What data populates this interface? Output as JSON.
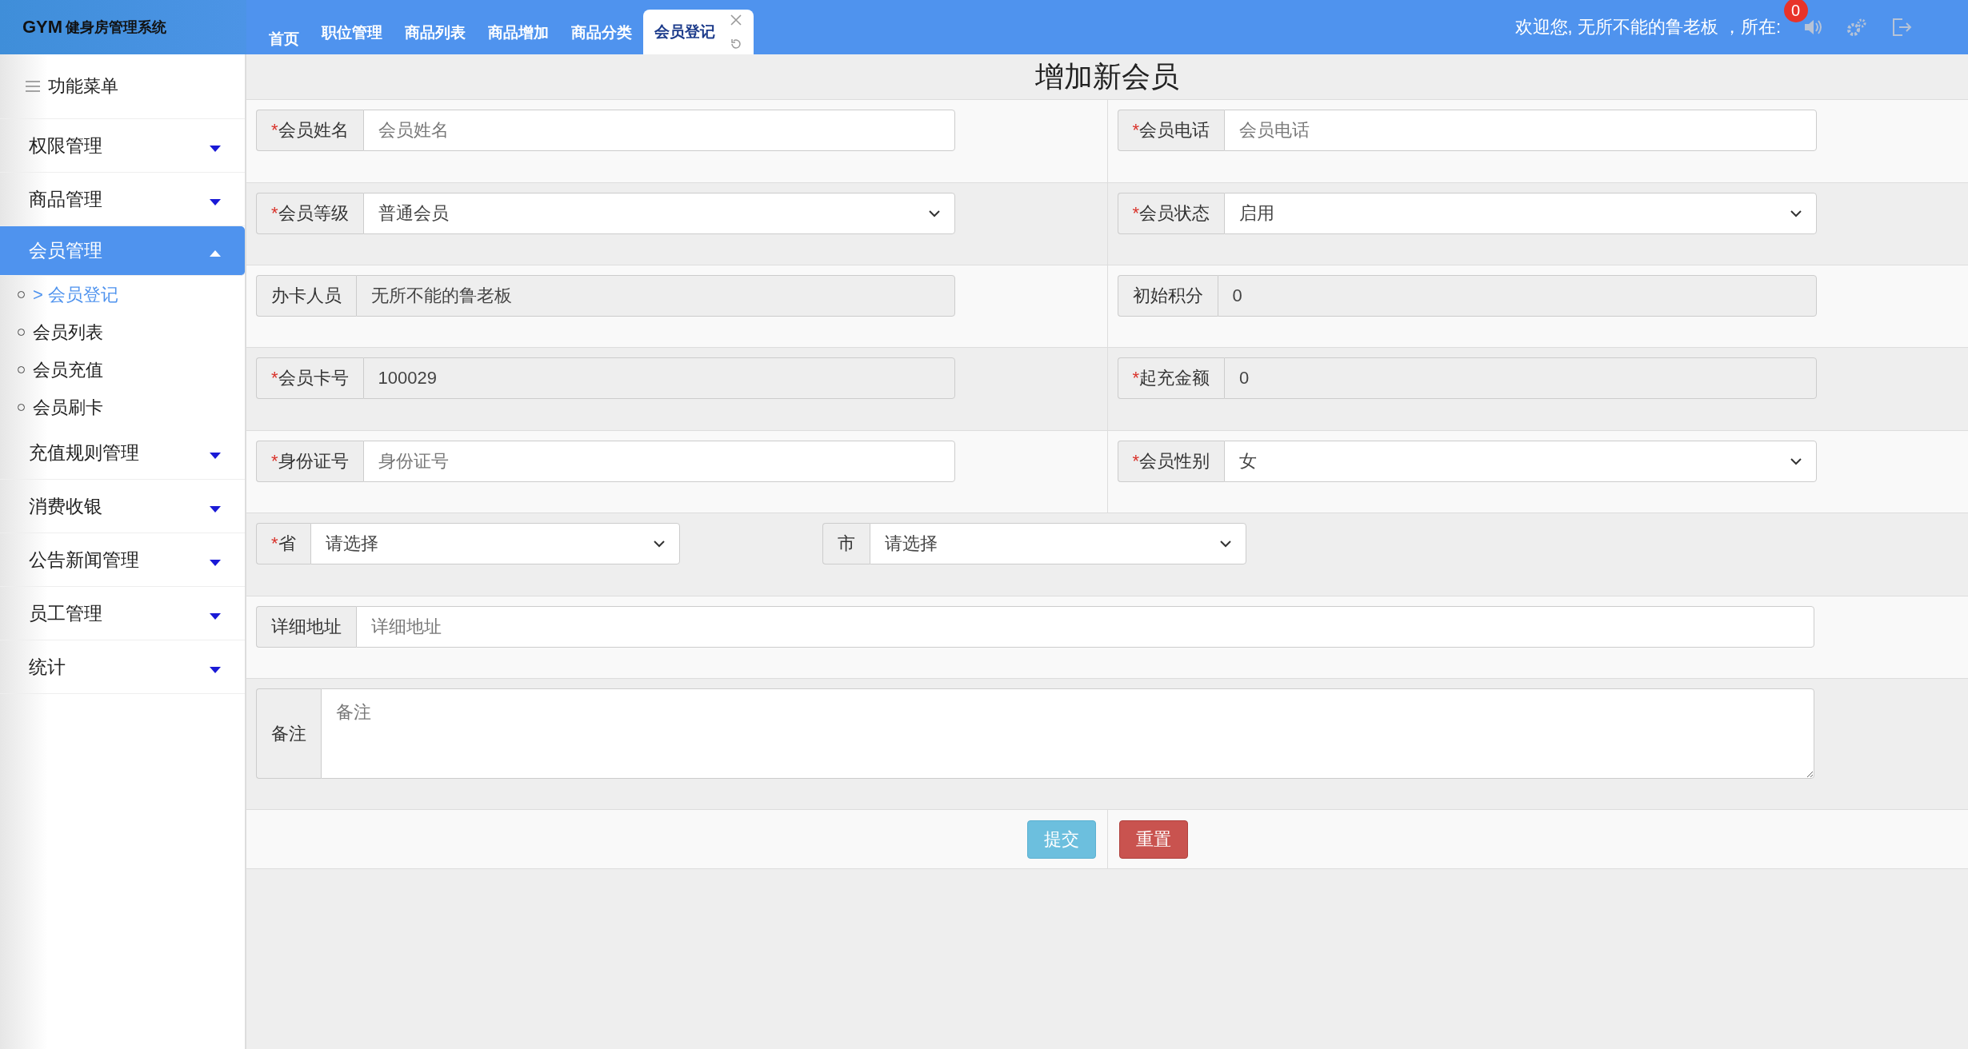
{
  "header": {
    "logo_mark": "GYM",
    "logo_text": "健身房管理系统",
    "welcome": "欢迎您, 无所不能的鲁老板 ，所在:",
    "notification_count": "0"
  },
  "tabs": [
    {
      "label": "首页",
      "selected": false,
      "closable": false
    },
    {
      "label": "职位管理",
      "selected": false,
      "closable": false
    },
    {
      "label": "商品列表",
      "selected": false,
      "closable": false
    },
    {
      "label": "商品增加",
      "selected": false,
      "closable": false
    },
    {
      "label": "商品分类",
      "selected": false,
      "closable": false
    },
    {
      "label": "会员登记",
      "selected": true,
      "closable": true
    }
  ],
  "sidebar": {
    "title": "功能菜单",
    "items": [
      {
        "label": "权限管理",
        "expanded": false
      },
      {
        "label": "商品管理",
        "expanded": false
      },
      {
        "label": "会员管理",
        "expanded": true,
        "children": [
          {
            "label": "> 会员登记",
            "selected": true
          },
          {
            "label": "会员列表",
            "selected": false
          },
          {
            "label": "会员充值",
            "selected": false
          },
          {
            "label": "会员刷卡",
            "selected": false
          }
        ]
      },
      {
        "label": "充值规则管理",
        "expanded": false
      },
      {
        "label": "消费收银",
        "expanded": false
      },
      {
        "label": "公告新闻管理",
        "expanded": false
      },
      {
        "label": "员工管理",
        "expanded": false
      },
      {
        "label": "统计",
        "expanded": false
      }
    ]
  },
  "form": {
    "title": "增加新会员",
    "rows": [
      {
        "kind": "split",
        "fields": [
          {
            "kind": "input",
            "required_mark": "*",
            "label": "会员姓名",
            "placeholder": "会员姓名"
          },
          {
            "kind": "input",
            "required_mark": "*",
            "label": "会员电话",
            "placeholder": "会员电话"
          }
        ]
      },
      {
        "kind": "split",
        "fields": [
          {
            "kind": "select",
            "required_mark": "*",
            "label": "会员等级",
            "value": "普通会员"
          },
          {
            "kind": "select",
            "required_mark": "*",
            "label": "会员状态",
            "value": "启用"
          }
        ]
      },
      {
        "kind": "split",
        "fields": [
          {
            "kind": "readonly",
            "label": "办卡人员",
            "value": "无所不能的鲁老板"
          },
          {
            "kind": "readonly",
            "label": "初始积分",
            "value": "0"
          }
        ]
      },
      {
        "kind": "split",
        "fields": [
          {
            "kind": "readonly",
            "required_mark": "*",
            "label": "会员卡号",
            "value": "100029"
          },
          {
            "kind": "readonly",
            "required_mark": "*",
            "label": "起充金额",
            "value": "0"
          }
        ]
      },
      {
        "kind": "split",
        "fields": [
          {
            "kind": "input",
            "required_mark": "*",
            "label": "身份证号",
            "placeholder": "身份证号"
          },
          {
            "kind": "select",
            "required_mark": "*",
            "label": "会员性别",
            "value": "女"
          }
        ]
      },
      {
        "kind": "inline",
        "fields": [
          {
            "kind": "select",
            "required_mark": "*",
            "label": "省",
            "value": "请选择"
          },
          {
            "kind": "select",
            "label": "市",
            "value": "请选择"
          }
        ]
      },
      {
        "kind": "full",
        "fields": [
          {
            "kind": "input",
            "label": "详细地址",
            "placeholder": "详细地址"
          }
        ]
      },
      {
        "kind": "full",
        "fields": [
          {
            "kind": "textarea",
            "label": "备注",
            "placeholder": "备注"
          }
        ]
      }
    ],
    "buttons": [
      {
        "label": "提交",
        "kind": "submit"
      },
      {
        "label": "重置",
        "kind": "reset"
      }
    ]
  }
}
